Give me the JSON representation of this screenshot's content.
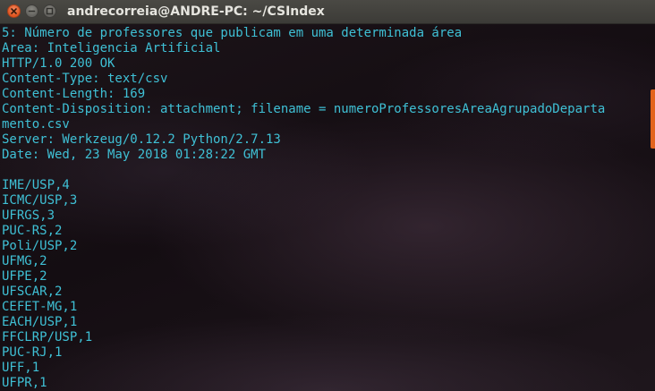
{
  "window": {
    "title": "andrecorreia@ANDRE-PC: ~/CSIndex",
    "colors": {
      "text": "#3fc0d5",
      "close_button": "#e0541f",
      "scrollbar": "#e2641d",
      "titlebar": "#3c3b37"
    },
    "buttons": {
      "close_icon": "close-icon",
      "minimize_icon": "minimize-icon",
      "maximize_icon": "maximize-icon"
    }
  },
  "terminal": {
    "lines": [
      "5: Número de professores que publicam em uma determinada área",
      "Area: Inteligencia Artificial",
      "HTTP/1.0 200 OK",
      "Content-Type: text/csv",
      "Content-Length: 169",
      "Content-Disposition: attachment; filename = numeroProfessoresAreaAgrupadoDeparta",
      "mento.csv",
      "Server: Werkzeug/0.12.2 Python/2.7.13",
      "Date: Wed, 23 May 2018 01:28:22 GMT",
      "",
      "IME/USP,4",
      "ICMC/USP,3",
      "UFRGS,3",
      "PUC-RS,2",
      "Poli/USP,2",
      "UFMG,2",
      "UFPE,2",
      "UFSCAR,2",
      "CEFET-MG,1",
      "EACH/USP,1",
      "FFCLRP/USP,1",
      "PUC-RJ,1",
      "UFF,1",
      "UFPR,1"
    ]
  }
}
